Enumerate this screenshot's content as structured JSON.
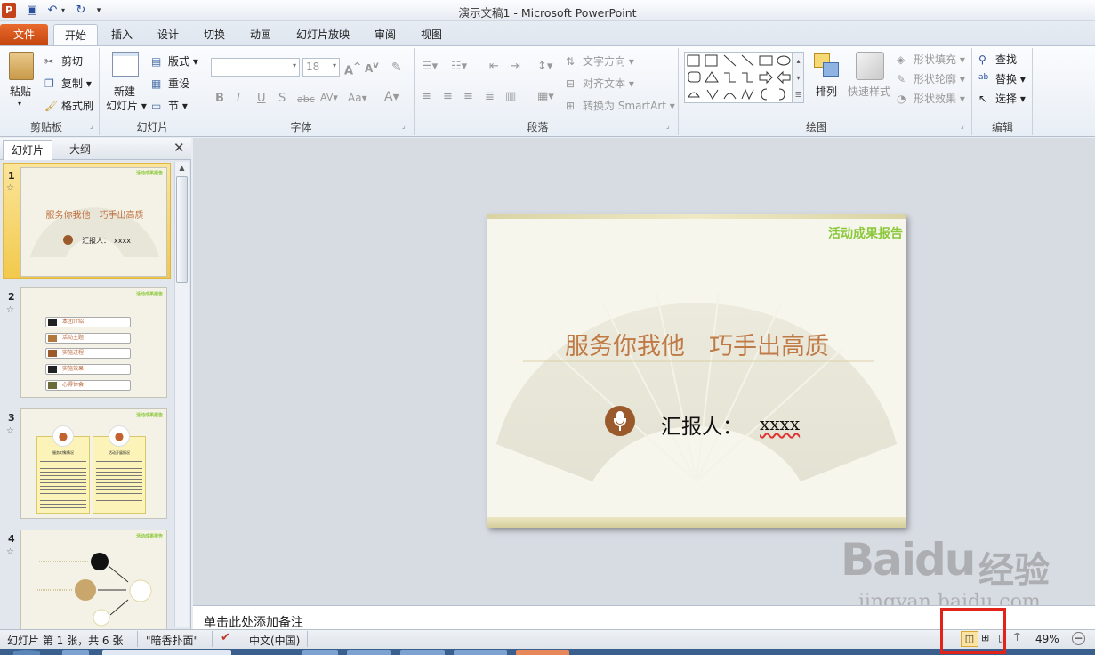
{
  "window": {
    "title": "演示文稿1 - Microsoft PowerPoint"
  },
  "tabs": [
    "文件",
    "开始",
    "插入",
    "设计",
    "切换",
    "动画",
    "幻灯片放映",
    "审阅",
    "视图"
  ],
  "ribbon": {
    "clipboard": {
      "paste": "粘贴",
      "cut": "剪切",
      "copy": "复制",
      "format_painter": "格式刷",
      "label": "剪贴板"
    },
    "slides": {
      "new_slide_line1": "新建",
      "new_slide_line2": "幻灯片",
      "layout": "版式",
      "reset": "重设",
      "section": "节",
      "label": "幻灯片"
    },
    "font": {
      "font_name": "",
      "font_size": "18",
      "label": "字体"
    },
    "paragraph": {
      "text_direction": "文字方向",
      "align_text": "对齐文本",
      "convert_smartart": "转换为 SmartArt",
      "label": "段落"
    },
    "drawing": {
      "arrange": "排列",
      "quick_styles": "快速样式",
      "shape_fill": "形状填充",
      "shape_outline": "形状轮廓",
      "shape_effects": "形状效果",
      "label": "绘图"
    },
    "editing": {
      "find": "查找",
      "replace": "替换",
      "select": "选择",
      "label": "编辑"
    }
  },
  "left_pane": {
    "tab_slides": "幻灯片",
    "tab_outline": "大纲",
    "thumbnails": [
      {
        "num": "1",
        "header": "活动成果报告",
        "title": "服务你我他　巧手出高质",
        "reporter": "汇报人：　xxxx"
      },
      {
        "num": "2",
        "header": "活动成果报告",
        "items": [
          "本团介绍",
          "活动主题",
          "实施过程",
          "实施效果",
          "心得体会"
        ]
      },
      {
        "num": "3",
        "header": "活动成果报告",
        "col1": "服务对象情况",
        "col2": "活动开展情况"
      },
      {
        "num": "4",
        "header": "活动成果报告"
      }
    ]
  },
  "slide": {
    "header": "活动成果报告",
    "title": "服务你我他　巧手出高质",
    "reporter_label": "汇报人：",
    "reporter_value": "xxxx"
  },
  "notes_placeholder": "单击此处添加备注",
  "status": {
    "slide_info": "幻灯片 第 1 张，共 6 张",
    "theme": "\"暗香扑面\"",
    "language": "中文(中国)",
    "zoom": "49%"
  },
  "watermark": {
    "brand": "Baidu",
    "service": "经验",
    "url": "jingyan.baidu.com"
  },
  "colors": {
    "accent_orange": "#b8643a",
    "header_green": "#8cc83c",
    "file_tab": "#d9541b",
    "highlight": "#e2231a"
  }
}
